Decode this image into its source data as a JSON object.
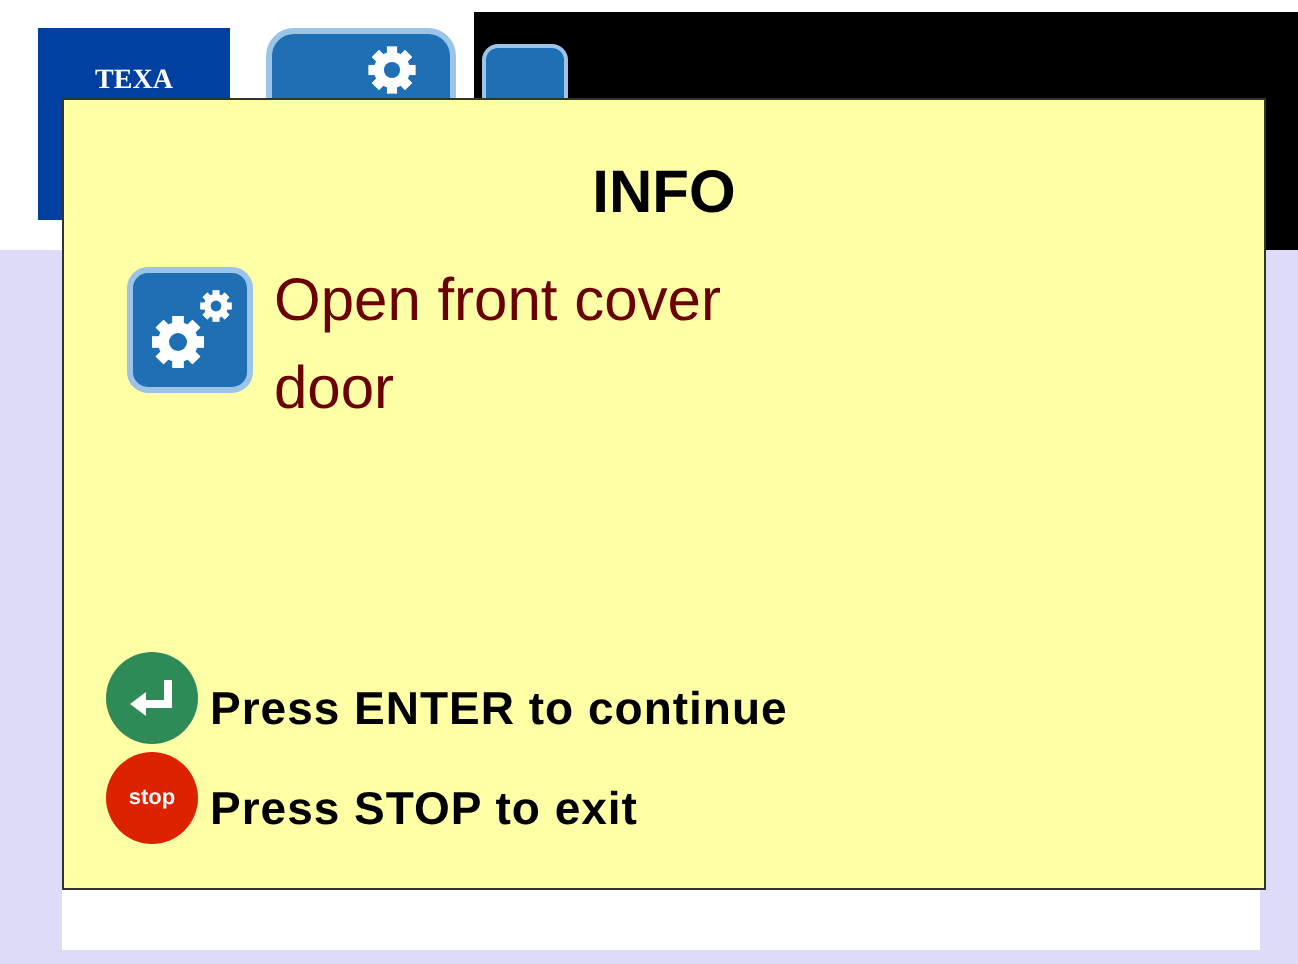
{
  "header": {
    "logo": "TEXA"
  },
  "dialog": {
    "title": "INFO",
    "message": "Open front cover door",
    "actions": [
      {
        "kind": "enter",
        "text": "Press ENTER to continue"
      },
      {
        "kind": "stop",
        "icon_text": "stop",
        "text": "Press STOP to exit"
      }
    ]
  }
}
